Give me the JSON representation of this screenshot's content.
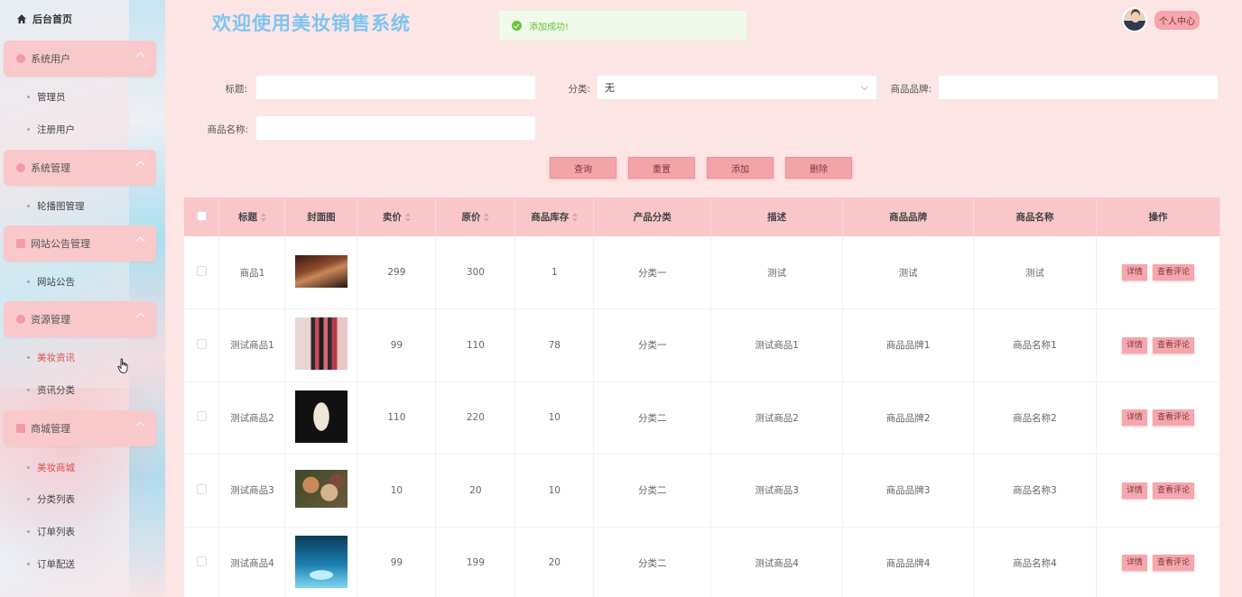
{
  "sidebar": {
    "home": "后台首页",
    "groups": [
      {
        "label": "系统用户",
        "icon": "user-icon",
        "items": [
          "管理员",
          "注册用户"
        ]
      },
      {
        "label": "系统管理",
        "icon": "settings-icon",
        "items": [
          "轮播图管理"
        ]
      },
      {
        "label": "网站公告管理",
        "icon": "notice-icon",
        "items": [
          "网站公告"
        ]
      },
      {
        "label": "资源管理",
        "icon": "resource-icon",
        "items": [
          "美妆资讯",
          "资讯分类"
        ]
      },
      {
        "label": "商城管理",
        "icon": "shop-icon",
        "items": [
          "美妆商城",
          "分类列表",
          "订单列表",
          "订单配送"
        ]
      }
    ]
  },
  "header": {
    "title": "欢迎使用美妆销售系统",
    "toast": "添加成功!",
    "user_center": "个人中心"
  },
  "search": {
    "title_label": "标题:",
    "title_value": "",
    "category_label": "分类:",
    "category_value": "无",
    "brand_label": "商品品牌:",
    "brand_value": "",
    "name_label": "商品名称:",
    "name_value": "",
    "buttons": {
      "query": "查询",
      "reset": "重置",
      "add": "添加",
      "delete": "删除"
    }
  },
  "table": {
    "headers": [
      "标题",
      "封面图",
      "卖价",
      "原价",
      "商品库存",
      "产品分类",
      "描述",
      "商品品牌",
      "商品名称",
      "操作"
    ],
    "rows": [
      {
        "title": "商品1",
        "price": "299",
        "original": "300",
        "stock": "1",
        "category": "分类一",
        "desc": "测试",
        "brand": "测试",
        "name": "测试"
      },
      {
        "title": "测试商品1",
        "price": "99",
        "original": "110",
        "stock": "78",
        "category": "分类一",
        "desc": "测试商品1",
        "brand": "商品品牌1",
        "name": "商品名称1"
      },
      {
        "title": "测试商品2",
        "price": "110",
        "original": "220",
        "stock": "10",
        "category": "分类二",
        "desc": "测试商品2",
        "brand": "商品品牌2",
        "name": "商品名称2"
      },
      {
        "title": "测试商品3",
        "price": "10",
        "original": "20",
        "stock": "10",
        "category": "分类二",
        "desc": "测试商品3",
        "brand": "商品品牌3",
        "name": "商品名称3"
      },
      {
        "title": "测试商品4",
        "price": "99",
        "original": "199",
        "stock": "20",
        "category": "分类二",
        "desc": "测试商品4",
        "brand": "商品品牌4",
        "name": "商品名称4"
      }
    ],
    "ops": {
      "detail": "详情",
      "comments": "查看评论"
    }
  },
  "colors": {
    "accent": "#f4a3a8",
    "header_bg": "#f9c7ca",
    "title": "#7dc6f0",
    "success": "#67c23a"
  }
}
